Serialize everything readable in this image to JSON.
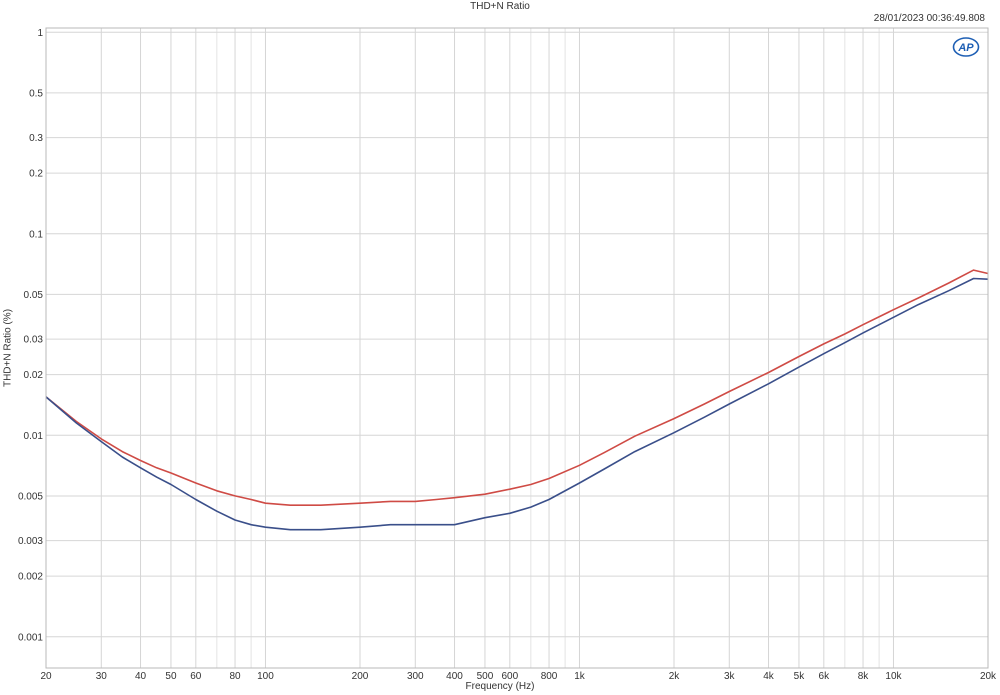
{
  "chart_data": {
    "type": "line",
    "title": "THD+N Ratio",
    "timestamp": "28/01/2023 00:36:49.808",
    "logo_text": "AP",
    "xlabel": "Frequency (Hz)",
    "ylabel": "THD+N Ratio (%)",
    "x_scale": "log",
    "y_scale": "log",
    "xlim": [
      20,
      20000
    ],
    "ylim": [
      0.0007,
      1.05
    ],
    "grid": true,
    "x_ticks": [
      {
        "v": 20,
        "label": "20"
      },
      {
        "v": 30,
        "label": "30"
      },
      {
        "v": 40,
        "label": "40"
      },
      {
        "v": 50,
        "label": "50"
      },
      {
        "v": 60,
        "label": "60"
      },
      {
        "v": 80,
        "label": "80"
      },
      {
        "v": 100,
        "label": "100"
      },
      {
        "v": 200,
        "label": "200"
      },
      {
        "v": 300,
        "label": "300"
      },
      {
        "v": 400,
        "label": "400"
      },
      {
        "v": 500,
        "label": "500"
      },
      {
        "v": 600,
        "label": "600"
      },
      {
        "v": 800,
        "label": "800"
      },
      {
        "v": 1000,
        "label": "1k"
      },
      {
        "v": 2000,
        "label": "2k"
      },
      {
        "v": 3000,
        "label": "3k"
      },
      {
        "v": 4000,
        "label": "4k"
      },
      {
        "v": 5000,
        "label": "5k"
      },
      {
        "v": 6000,
        "label": "6k"
      },
      {
        "v": 8000,
        "label": "8k"
      },
      {
        "v": 10000,
        "label": "10k"
      },
      {
        "v": 20000,
        "label": "20k"
      }
    ],
    "y_ticks": [
      {
        "v": 1,
        "label": "1"
      },
      {
        "v": 0.5,
        "label": "0.5"
      },
      {
        "v": 0.3,
        "label": "0.3"
      },
      {
        "v": 0.2,
        "label": "0.2"
      },
      {
        "v": 0.1,
        "label": "0.1"
      },
      {
        "v": 0.05,
        "label": "0.05"
      },
      {
        "v": 0.03,
        "label": "0.03"
      },
      {
        "v": 0.02,
        "label": "0.02"
      },
      {
        "v": 0.01,
        "label": "0.01"
      },
      {
        "v": 0.005,
        "label": "0.005"
      },
      {
        "v": 0.003,
        "label": "0.003"
      },
      {
        "v": 0.002,
        "label": "0.002"
      },
      {
        "v": 0.001,
        "label": "0.001"
      }
    ],
    "x_minor": [
      70,
      90,
      700,
      900,
      7000,
      9000
    ],
    "series": [
      {
        "color": "#cf4b45",
        "x": [
          20,
          25,
          30,
          35,
          40,
          45,
          50,
          60,
          70,
          80,
          90,
          100,
          120,
          150,
          200,
          250,
          300,
          350,
          400,
          500,
          600,
          700,
          800,
          1000,
          1200,
          1500,
          2000,
          2500,
          3000,
          4000,
          5000,
          6000,
          7000,
          8000,
          10000,
          12000,
          15000,
          18000,
          20000
        ],
        "y": [
          0.0155,
          0.0117,
          0.0096,
          0.0083,
          0.0075,
          0.0069,
          0.0065,
          0.0058,
          0.0053,
          0.005,
          0.0048,
          0.0046,
          0.0045,
          0.0045,
          0.0046,
          0.0047,
          0.0047,
          0.0048,
          0.0049,
          0.0051,
          0.0054,
          0.0057,
          0.0061,
          0.0071,
          0.0082,
          0.0099,
          0.0121,
          0.0143,
          0.0165,
          0.0205,
          0.0246,
          0.0284,
          0.0318,
          0.0354,
          0.042,
          0.048,
          0.057,
          0.066,
          0.0635
        ]
      },
      {
        "color": "#3a4f8a",
        "x": [
          20,
          25,
          30,
          35,
          40,
          45,
          50,
          60,
          70,
          80,
          90,
          100,
          120,
          150,
          200,
          250,
          300,
          350,
          400,
          500,
          600,
          700,
          800,
          1000,
          1200,
          1500,
          2000,
          2500,
          3000,
          4000,
          5000,
          6000,
          7000,
          8000,
          10000,
          12000,
          15000,
          18000,
          20000
        ],
        "y": [
          0.0155,
          0.0115,
          0.0093,
          0.0078,
          0.0069,
          0.0062,
          0.0057,
          0.0048,
          0.0042,
          0.0038,
          0.0036,
          0.0035,
          0.0034,
          0.0034,
          0.0035,
          0.0036,
          0.0036,
          0.0036,
          0.0036,
          0.0039,
          0.0041,
          0.0044,
          0.0048,
          0.0058,
          0.0068,
          0.0083,
          0.0103,
          0.0123,
          0.0143,
          0.018,
          0.0218,
          0.0254,
          0.0288,
          0.0322,
          0.0385,
          0.0445,
          0.0522,
          0.06,
          0.0595
        ]
      }
    ]
  }
}
